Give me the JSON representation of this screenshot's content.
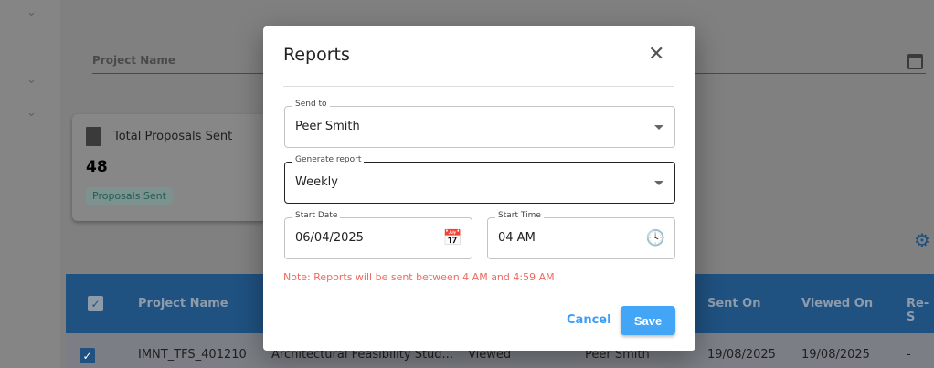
{
  "background": {
    "project_name_label": "Project Name",
    "card": {
      "title": "Total Proposals Sent",
      "count": "48",
      "badge": "Proposals Sent"
    },
    "table": {
      "headers": [
        "Project Name",
        "Sent On",
        "Viewed On",
        "Re-S"
      ],
      "row": [
        "IMNT_TFS_401210",
        "Architectural Feasibility Stud...",
        "Viewed",
        "Peer Smith",
        "19/08/2025",
        "19/08/2025",
        "-"
      ]
    }
  },
  "dialog": {
    "title": "Reports",
    "send_to": {
      "label": "Send to",
      "value": "Peer Smith"
    },
    "generate_report": {
      "label": "Generate report",
      "value": "Weekly"
    },
    "start_date": {
      "label": "Start Date",
      "value": "06/04/2025"
    },
    "start_time": {
      "label": "Start Time",
      "value": "04 AM"
    },
    "note": "Note: Reports will be sent between 4 AM and 4:59 AM",
    "cancel_label": "Cancel",
    "save_label": "Save"
  },
  "colors": {
    "accent": "#42a5f5",
    "note": "#f06a5f",
    "table_header": "#1f5181"
  }
}
